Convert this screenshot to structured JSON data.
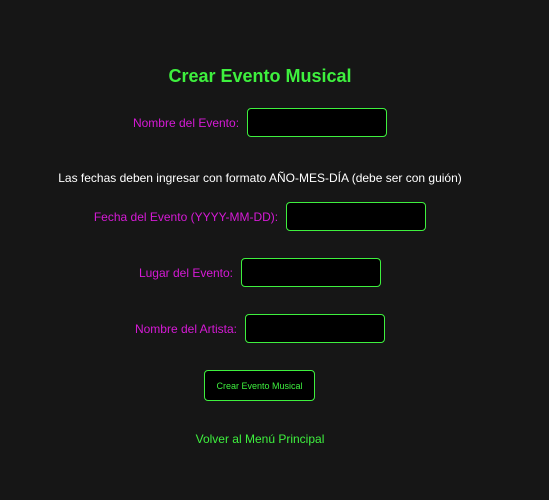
{
  "page": {
    "title": "Crear Evento Musical",
    "date_note": "Las fechas deben ingresar con formato AÑO-MES-DÍA (debe ser con guión)",
    "submit_label": "Crear Evento Musical",
    "back_link": "Volver al Menú Principal"
  },
  "fields": {
    "event_name": {
      "label": "Nombre del Evento:",
      "value": ""
    },
    "event_date": {
      "label": "Fecha del Evento (YYYY-MM-DD):",
      "value": ""
    },
    "event_place": {
      "label": "Lugar del Evento:",
      "value": ""
    },
    "artist_name": {
      "label": "Nombre del Artista:",
      "value": ""
    }
  },
  "colors": {
    "accent": "#3ef03e",
    "label": "#d61ad6",
    "background": "#161616",
    "input_background": "#000000"
  }
}
